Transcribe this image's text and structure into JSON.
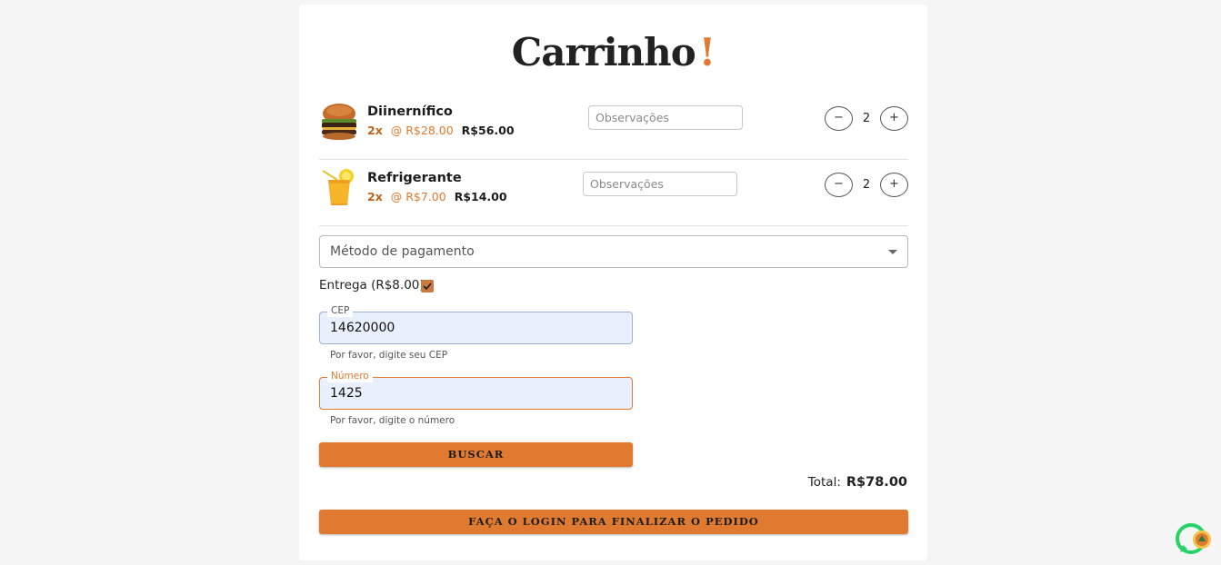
{
  "title": "Carrinho",
  "title_accent": "!",
  "items": [
    {
      "name": "Diinernífico",
      "qty": "2x",
      "unit_price": "@ R$28.00",
      "subtotal": "R$56.00",
      "obs_placeholder": "Observações",
      "count": "2",
      "icon": "burger-icon"
    },
    {
      "name": "Refrigerante",
      "qty": "2x",
      "unit_price": "@ R$7.00",
      "subtotal": "R$14.00",
      "obs_placeholder": "Observações",
      "count": "2",
      "icon": "juice-icon"
    }
  ],
  "stepper": {
    "minus": "−",
    "plus": "+"
  },
  "payment": {
    "label": "Método de pagamento"
  },
  "delivery": {
    "label": "Entrega (R$8.00)",
    "checked": true
  },
  "cep": {
    "label": "CEP",
    "value": "14620000",
    "helper": "Por favor, digite seu CEP"
  },
  "numero": {
    "label": "Número",
    "value": "1425",
    "helper": "Por favor, digite o número"
  },
  "search_button": "BUSCAR",
  "total": {
    "label": "Total:",
    "value": "R$78.00"
  },
  "finalize_button": "FAÇA O LOGIN PARA FINALIZAR O PEDIDO",
  "colors": {
    "accent": "#e07a30",
    "field_bg": "#e8f0fe"
  }
}
